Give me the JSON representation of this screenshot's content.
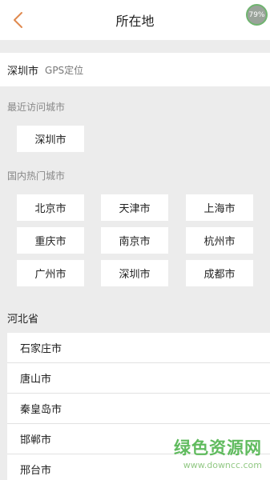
{
  "header": {
    "title": "所在地"
  },
  "gps": {
    "city": "深圳市",
    "label": "GPS定位",
    "badge": "79%"
  },
  "recent": {
    "title": "最近访问城市",
    "cities": [
      "深圳市"
    ]
  },
  "hot": {
    "title": "国内热门城市",
    "cities": [
      "北京市",
      "天津市",
      "上海市",
      "重庆市",
      "南京市",
      "杭州市",
      "广州市",
      "深圳市",
      "成都市"
    ]
  },
  "province": {
    "name": "河北省",
    "cities": [
      "石家庄市",
      "唐山市",
      "秦皇岛市",
      "邯郸市",
      "邢台市"
    ]
  },
  "watermark": {
    "main": "绿色资源网",
    "sub": "www.downcc.com"
  },
  "colors": {
    "accent": "#e08a4f",
    "watermark": "#45b043",
    "background": "#ececec"
  },
  "icons": {
    "back": "back-chevron-icon"
  }
}
